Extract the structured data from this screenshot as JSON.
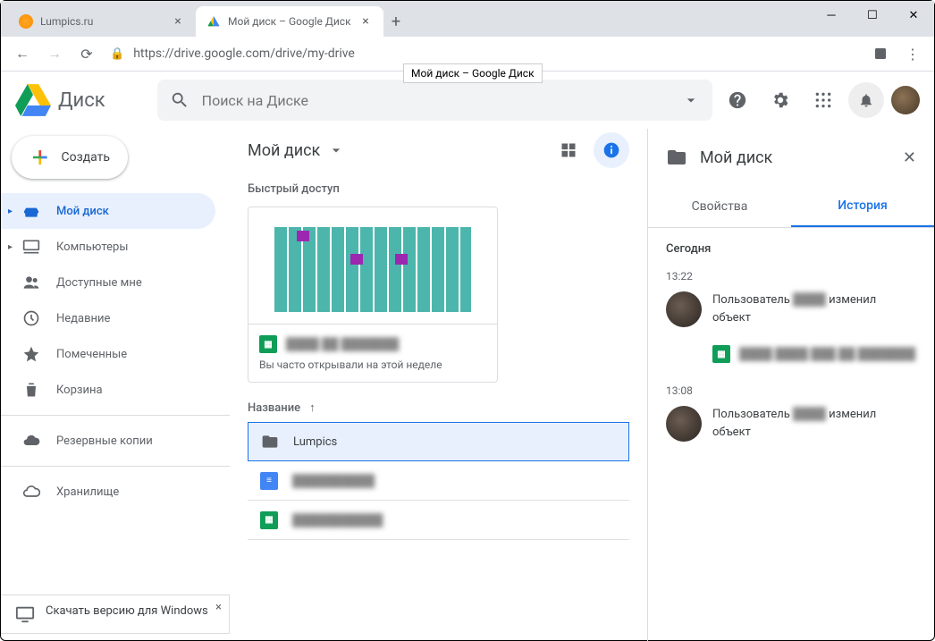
{
  "browser": {
    "tabs": [
      {
        "title": "Lumpics.ru",
        "active": false
      },
      {
        "title": "Мой диск – Google Диск",
        "active": true
      }
    ],
    "url": "https://drive.google.com/drive/my-drive",
    "tooltip": "Мой диск – Google Диск"
  },
  "app": {
    "name": "Диск",
    "search_placeholder": "Поиск на Диске",
    "create_label": "Создать"
  },
  "sidebar": {
    "items": [
      {
        "label": "Мой диск",
        "icon": "drive-icon",
        "active": true,
        "expandable": true
      },
      {
        "label": "Компьютеры",
        "icon": "computers-icon",
        "expandable": true
      },
      {
        "label": "Доступные мне",
        "icon": "shared-icon"
      },
      {
        "label": "Недавние",
        "icon": "recent-icon"
      },
      {
        "label": "Помеченные",
        "icon": "star-icon"
      },
      {
        "label": "Корзина",
        "icon": "trash-icon"
      }
    ],
    "backups": "Резервные копии",
    "storage": "Хранилище",
    "download_banner": "Скачать версию для Windows"
  },
  "content": {
    "path": "Мой диск",
    "quick_access_label": "Быстрый доступ",
    "quick_card_sub": "Вы часто открывали на этой неделе",
    "name_header": "Название",
    "files": [
      {
        "name": "Lumpics",
        "type": "folder",
        "selected": true
      },
      {
        "name": "",
        "type": "docs",
        "blurred": true
      },
      {
        "name": "",
        "type": "sheets",
        "blurred": true
      }
    ]
  },
  "details": {
    "title": "Мой диск",
    "tab_props": "Свойства",
    "tab_history": "История",
    "today": "Сегодня",
    "entries": [
      {
        "time": "13:22",
        "text_prefix": "Пользователь",
        "text_suffix": "изменил объект"
      },
      {
        "time": "13:08",
        "text_prefix": "Пользователь",
        "text_suffix": "изменил объект"
      }
    ]
  }
}
